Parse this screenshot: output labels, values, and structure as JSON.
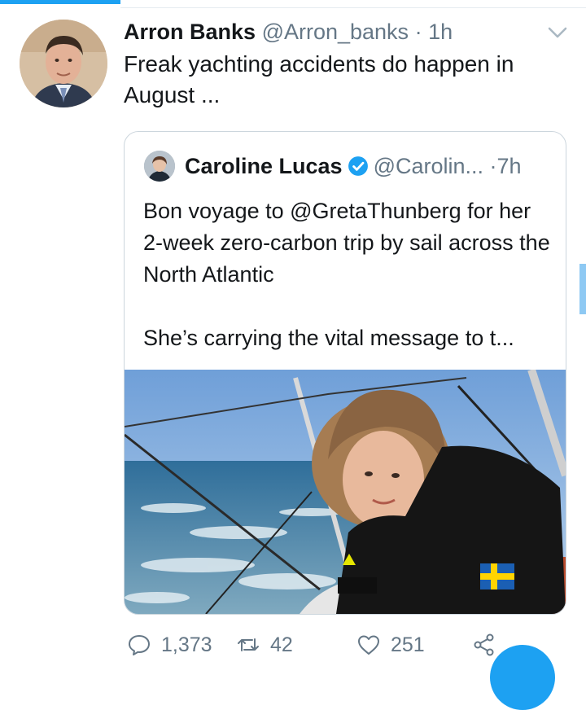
{
  "tweet": {
    "display_name": "Arron Banks",
    "handle": "@Arron_banks",
    "separator": "·",
    "time": "1h",
    "text": "Freak yachting accidents do happen in August ...",
    "avatar_icon": "person-photo-avatar",
    "menu_icon": "chevron-down-icon"
  },
  "quoted_tweet": {
    "display_name": "Caroline Lucas",
    "verified_icon": "verified-badge-icon",
    "handle": "@Carolin...",
    "separator": "·",
    "time": "7h",
    "paragraph_1": "Bon voyage to @GretaThunberg for her 2-week zero-carbon trip by sail across the North Atlantic",
    "paragraph_2": "She’s carrying the vital message to t...",
    "media_icon": "sailboat-photo"
  },
  "actions": {
    "reply_count": "1,373",
    "retweet_count": "42",
    "like_count": "251"
  },
  "colors": {
    "accent": "#1da1f2",
    "secondary_text": "#657786",
    "border": "#ccd6dd"
  }
}
